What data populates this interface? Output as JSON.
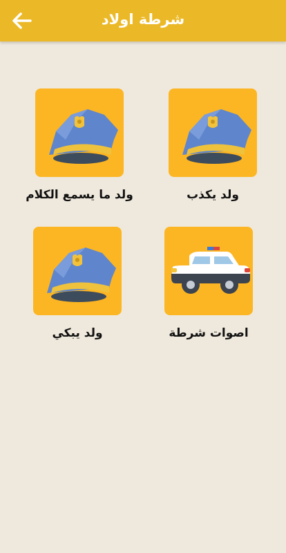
{
  "app_bar": {
    "title": "شرطة اولاد",
    "back_icon": "arrow-left-icon",
    "color": "#ebb928"
  },
  "items": [
    {
      "label": "ولد يكذب",
      "icon": "police-cap-icon"
    },
    {
      "label": "ولد ما يسمع الكلام",
      "icon": "police-cap-icon"
    },
    {
      "label": "اصوات شرطة",
      "icon": "police-car-icon"
    },
    {
      "label": "ولد يبكي",
      "icon": "police-cap-icon"
    }
  ],
  "colors": {
    "background": "#efe8dc",
    "tile": "#fcb623",
    "cap_blue": "#5c83c9"
  }
}
